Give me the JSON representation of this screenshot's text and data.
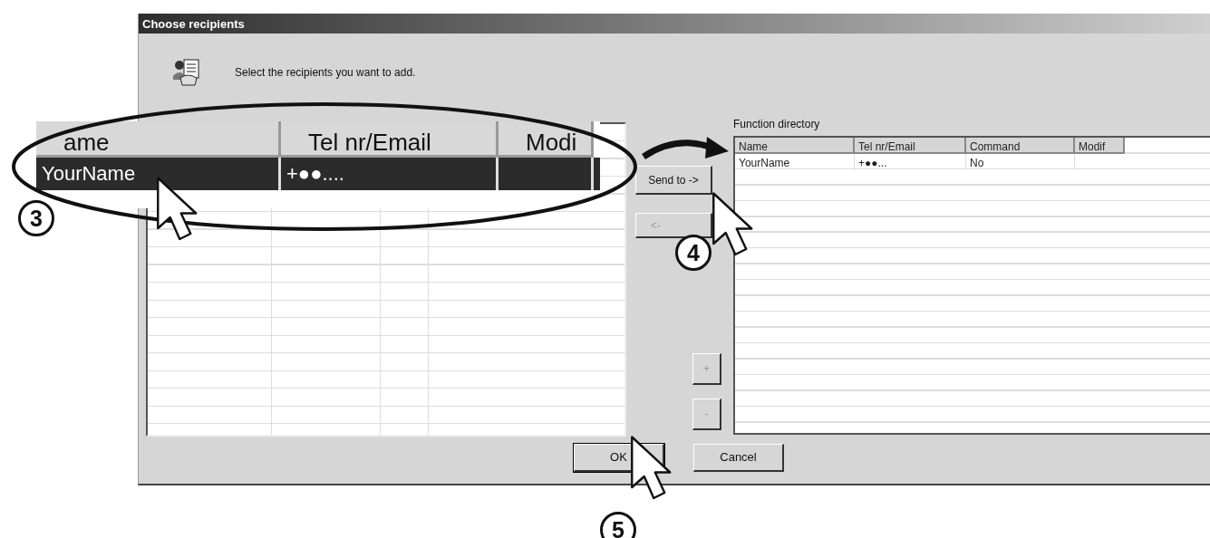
{
  "window": {
    "title": "Choose recipients"
  },
  "instruction": "Select the recipients you want to add.",
  "recipients_table": {
    "columns": [
      "ame",
      "Tel nr/Email",
      "Modi"
    ],
    "rows": [
      {
        "cells": [
          "YourName",
          "+●●....",
          ""
        ],
        "selected": true
      }
    ]
  },
  "side_buttons": [
    {
      "label": "Send to ->",
      "disabled": false
    },
    {
      "label": "<-",
      "disabled": true
    },
    {
      "label": "+",
      "disabled": true
    },
    {
      "label": "-",
      "disabled": true
    }
  ],
  "directory": {
    "label": "Function directory",
    "columns": [
      "Name",
      "Tel nr/Email",
      "Command",
      "Modif"
    ],
    "rows": [
      {
        "cells": [
          "YourName",
          "+●●...",
          "No",
          ""
        ]
      }
    ]
  },
  "dialog_buttons": [
    {
      "label": "OK",
      "default": true
    },
    {
      "label": "Cancel",
      "default": false
    }
  ],
  "step_numbers": [
    "3",
    "4",
    "5"
  ]
}
